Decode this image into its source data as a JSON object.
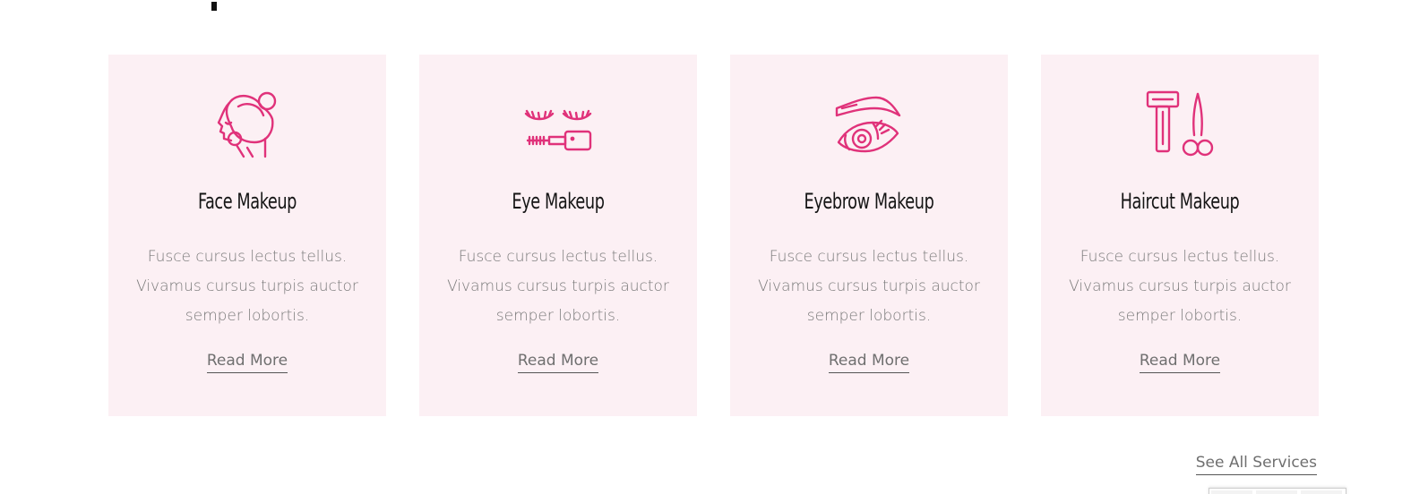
{
  "accent_color": "#e0327a",
  "card_background": "#fcf0f4",
  "services": [
    {
      "icon": "face-makeup-icon",
      "title": "Face Makeup",
      "desc_line1": "Fusce cursus lectus tellus.",
      "desc_line2": "Vivamus cursus turpis auctor",
      "desc_line3": "semper lobortis.",
      "link": "Read More"
    },
    {
      "icon": "eye-makeup-icon",
      "title": "Eye Makeup",
      "desc_line1": "Fusce cursus lectus tellus.",
      "desc_line2": "Vivamus cursus turpis auctor",
      "desc_line3": "semper lobortis.",
      "link": "Read More"
    },
    {
      "icon": "eyebrow-makeup-icon",
      "title": "Eyebrow Makeup",
      "desc_line1": "Fusce cursus lectus tellus.",
      "desc_line2": "Vivamus cursus turpis auctor",
      "desc_line3": "semper lobortis.",
      "link": "Read More"
    },
    {
      "icon": "haircut-makeup-icon",
      "title": "Haircut Makeup",
      "desc_line1": "Fusce cursus lectus tellus.",
      "desc_line2": "Vivamus cursus turpis auctor",
      "desc_line3": "semper lobortis.",
      "link": "Read More"
    }
  ],
  "see_all_label": "See All Services"
}
